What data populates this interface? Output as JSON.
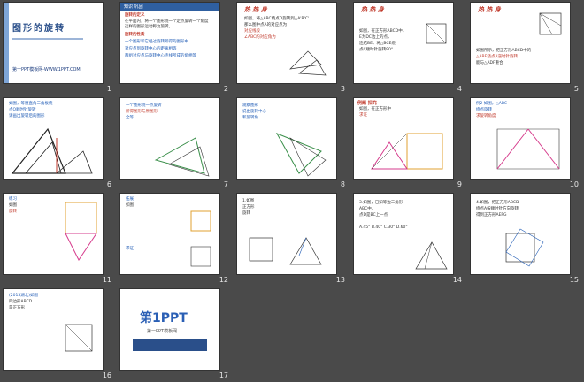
{
  "slides": [
    {
      "num": "1",
      "title": "图形的旋转",
      "subtitle": "第一PPT模板网-WWW.1PPT.COM"
    },
    {
      "num": "2",
      "lines": [
        "旋转的定义",
        "在平面内，将一个图形绕一个定点旋转一个角度",
        "这样的图形运动称为旋转。",
        "旋转的性质",
        "一个图形和它经过旋转所得的图形中",
        "对应点到旋转中心的距离相等",
        "两组对应点与旋转中心连线所成的角相等"
      ],
      "label": "知识 巩固"
    },
    {
      "num": "3",
      "header": "热 热 身",
      "lines": [
        "如图，将△ABC绕点O旋转到△A'B'C'",
        "那么图中点A的对应点为",
        "对应线段",
        "∠ABC的对应角为"
      ]
    },
    {
      "num": "4",
      "header": "热 热 身",
      "lines": [
        "如图，在正方形ABCD中，",
        "E为DC边上的点，",
        "连结BE，将△BCE绕",
        "点C顺时针旋转90°"
      ]
    },
    {
      "num": "5",
      "header": "热 热 身",
      "lines": [
        "如图所示，把正方形ABCD中的",
        "△ABE绕点A逆时针旋转",
        "能与△ADF重合"
      ]
    },
    {
      "num": "6",
      "lines": [
        "如图，等腰直角三角板绕",
        "点O顺时针旋转",
        "请画出旋转后的图形"
      ]
    },
    {
      "num": "7",
      "lines": [
        "一个图形绕一点旋转",
        "所得图形与原图形",
        "全等"
      ]
    },
    {
      "num": "8",
      "lines": [
        "观察图形",
        "说出旋转中心",
        "和旋转角"
      ]
    },
    {
      "num": "9",
      "lines": [
        "例题 探究",
        "如图，在正方形中",
        "求证"
      ]
    },
    {
      "num": "10",
      "lines": [
        "例2 如图，△ABC",
        "绕点旋转",
        "求旋转角度"
      ]
    },
    {
      "num": "11",
      "lines": [
        "练习",
        "如图",
        "旋转"
      ]
    },
    {
      "num": "12",
      "lines": [
        "拓展",
        "如图",
        "求证"
      ]
    },
    {
      "num": "13",
      "lines": [
        "1.如图",
        "正方形",
        "旋转"
      ]
    },
    {
      "num": "14",
      "lines": [
        "3.如图，已知等边三角形",
        "ABC中，",
        "点D是BC上一点"
      ],
      "options": "A.45°  B.40°  C.30°  D.60°"
    },
    {
      "num": "15",
      "lines": [
        "4.如图，把正方形ABCD",
        "绕点A按顺时针方向旋转",
        "得到正方形AEFG"
      ]
    },
    {
      "num": "16",
      "lines": [
        "(2013湖北)如图",
        "四边形ABCD",
        "是正方形"
      ]
    },
    {
      "num": "17",
      "logo": "第1PPT",
      "caption": "第一PPT模板网"
    }
  ],
  "colors": {
    "background": "#4a4a4a",
    "slide": "#ffffff",
    "accent": "#2a4f8a",
    "highlight": "#c0392b"
  }
}
